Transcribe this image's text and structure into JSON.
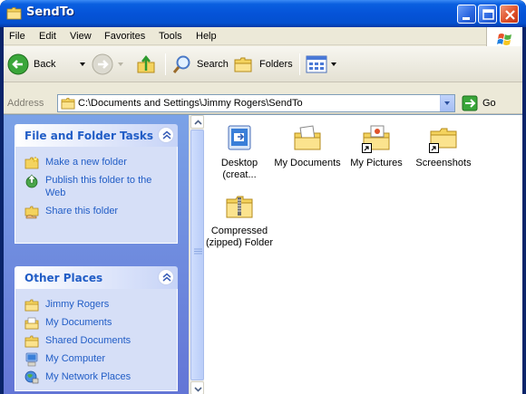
{
  "window": {
    "title": "SendTo",
    "colors": {
      "titlebar": "#0553d8",
      "close": "#e0522a",
      "taskpane": "#6f8ede",
      "link": "#215dc6"
    }
  },
  "menubar": {
    "items": [
      "File",
      "Edit",
      "View",
      "Favorites",
      "Tools",
      "Help"
    ]
  },
  "toolbar": {
    "back_label": "Back",
    "search_label": "Search",
    "folders_label": "Folders"
  },
  "address": {
    "label": "Address",
    "value": "C:\\Documents and Settings\\Jimmy Rogers\\SendTo",
    "go_label": "Go"
  },
  "taskpane": {
    "file_tasks": {
      "title": "File and Folder Tasks",
      "items": [
        {
          "label": "Make a new folder",
          "icon": "new-folder-icon"
        },
        {
          "label": "Publish this folder to the Web",
          "icon": "publish-web-icon"
        },
        {
          "label": "Share this folder",
          "icon": "share-folder-icon"
        }
      ]
    },
    "other_places": {
      "title": "Other Places",
      "items": [
        {
          "label": "Jimmy Rogers",
          "icon": "folder-icon"
        },
        {
          "label": "My Documents",
          "icon": "my-documents-icon"
        },
        {
          "label": "Shared Documents",
          "icon": "folder-icon"
        },
        {
          "label": "My Computer",
          "icon": "my-computer-icon"
        },
        {
          "label": "My Network Places",
          "icon": "network-places-icon"
        }
      ]
    }
  },
  "files": [
    {
      "label": "Desktop (creat...",
      "icon": "desktop-shortcut-icon"
    },
    {
      "label": "My Documents",
      "icon": "my-documents-folder-icon"
    },
    {
      "label": "My Pictures",
      "icon": "my-pictures-shortcut-icon"
    },
    {
      "label": "Screenshots",
      "icon": "screenshots-folder-shortcut-icon"
    },
    {
      "label": "Compressed (zipped) Folder",
      "icon": "zipped-folder-icon"
    }
  ]
}
